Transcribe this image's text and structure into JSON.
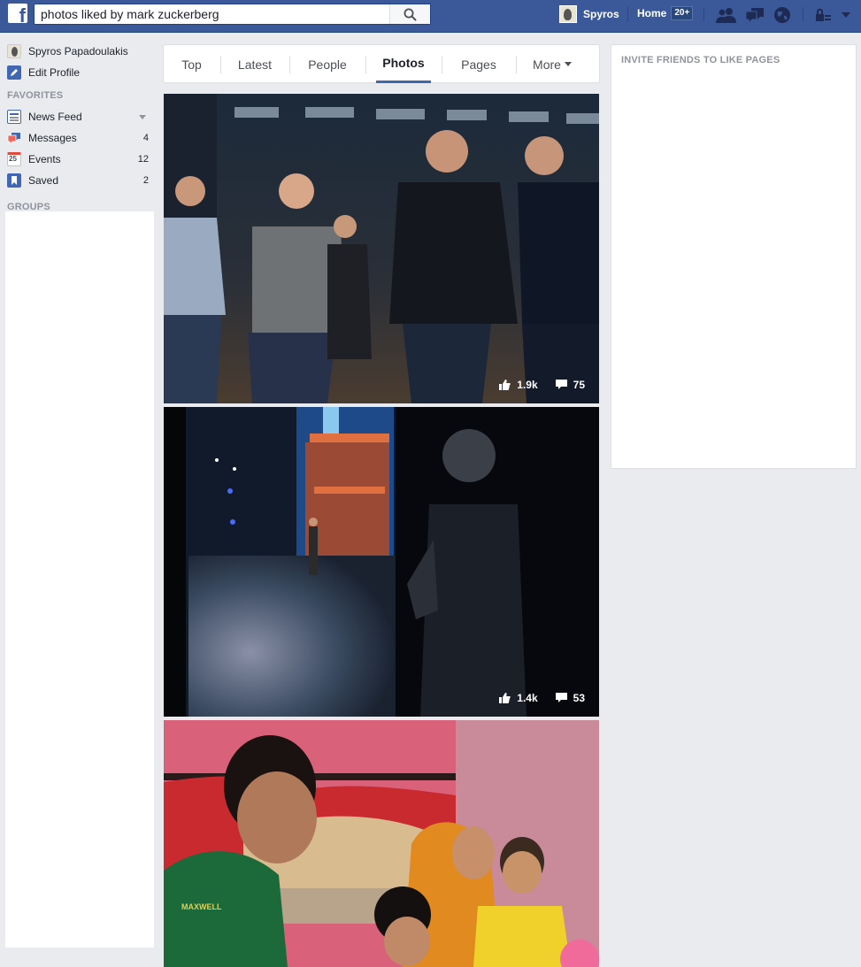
{
  "topbar": {
    "search_value": "photos liked by mark zuckerberg",
    "user_name": "Spyros",
    "home_label": "Home",
    "home_badge": "20+",
    "brand_color": "#3b5998"
  },
  "leftnav": {
    "profile_name": "Spyros Papadoulakis",
    "edit_profile": "Edit Profile",
    "favorites_heading": "FAVORITES",
    "favorites": [
      {
        "label": "News Feed",
        "count": ""
      },
      {
        "label": "Messages",
        "count": "4"
      },
      {
        "label": "Events",
        "count": "12"
      },
      {
        "label": "Saved",
        "count": "2"
      }
    ],
    "events_icon_text": "25",
    "groups_heading": "GROUPS"
  },
  "tabs": [
    {
      "label": "Top"
    },
    {
      "label": "Latest"
    },
    {
      "label": "People"
    },
    {
      "label": "Photos",
      "active": true
    },
    {
      "label": "Pages"
    },
    {
      "label": "More"
    }
  ],
  "photos": [
    {
      "likes": "1.9k",
      "comments": "75"
    },
    {
      "likes": "1.4k",
      "comments": "53"
    },
    {
      "likes": "",
      "comments": ""
    }
  ],
  "photo3_shirt_text": "MAXWELL",
  "right": {
    "title": "INVITE FRIENDS TO LIKE PAGES"
  }
}
